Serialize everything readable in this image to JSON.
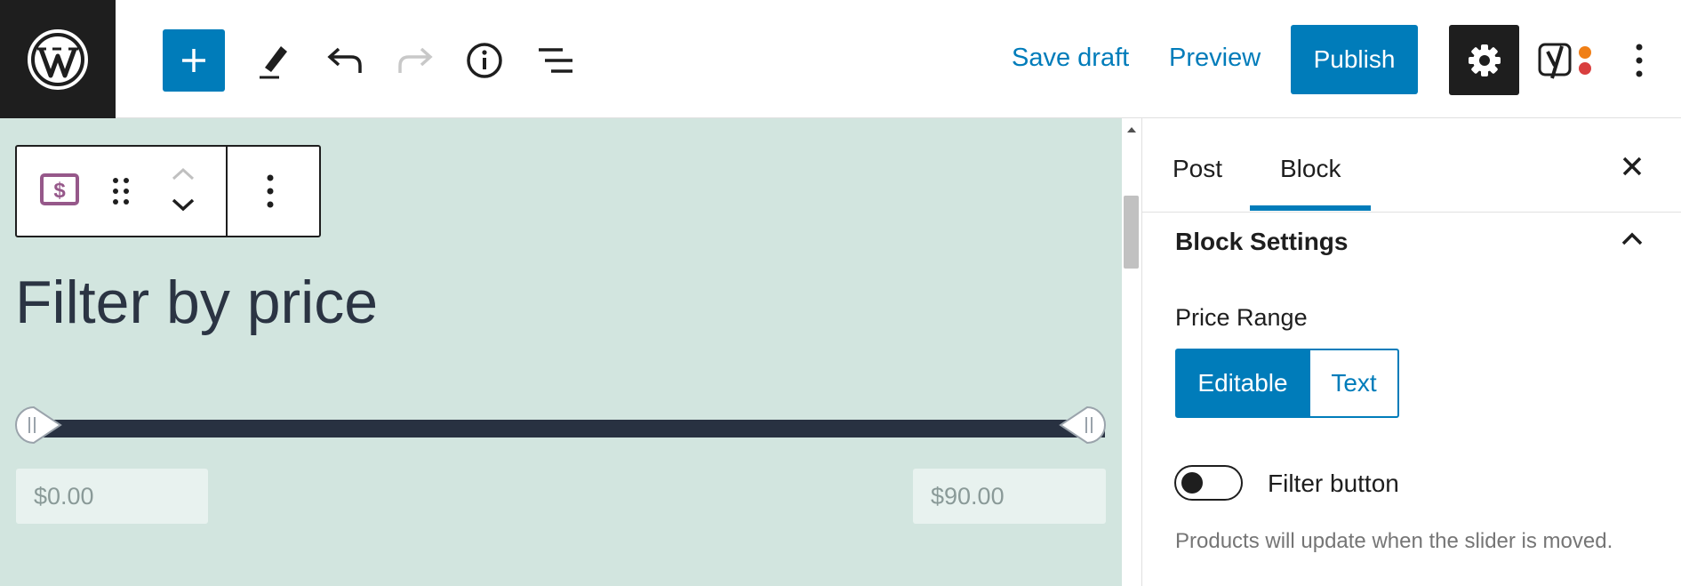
{
  "header": {
    "save_draft_label": "Save draft",
    "preview_label": "Preview",
    "publish_label": "Publish"
  },
  "block": {
    "heading": "Filter by price",
    "min_price": "$0.00",
    "max_price": "$90.00",
    "slider_min_fraction": 0.0,
    "slider_max_fraction": 1.0
  },
  "sidebar": {
    "tabs": [
      {
        "label": "Post",
        "active": false
      },
      {
        "label": "Block",
        "active": true
      }
    ],
    "panel_title": "Block Settings",
    "price_range_label": "Price Range",
    "price_range_options": [
      "Editable",
      "Text"
    ],
    "price_range_selected": "Editable",
    "filter_button_label": "Filter button",
    "filter_button_enabled": false,
    "help_text": "Products will update when the slider is moved."
  },
  "colors": {
    "accent": "#007cba",
    "dark": "#1e1e1e",
    "canvas_bg": "#d2e5df",
    "track": "#283141",
    "block_icon": "#96588a",
    "yoast_orange": "#f07f16",
    "yoast_red": "#d93f3f"
  },
  "icons": {
    "logo": "wordpress-logo",
    "inserter": "plus-icon",
    "tools": "pen-icon",
    "undo": "undo-icon",
    "redo": "redo-icon",
    "details": "info-icon",
    "outline": "list-view-icon",
    "settings": "gear-icon",
    "yoast": "yoast-icon",
    "options": "kebab-menu-icon",
    "block_type": "price-filter-icon",
    "drag": "drag-handle-icon",
    "close": "close-icon"
  }
}
